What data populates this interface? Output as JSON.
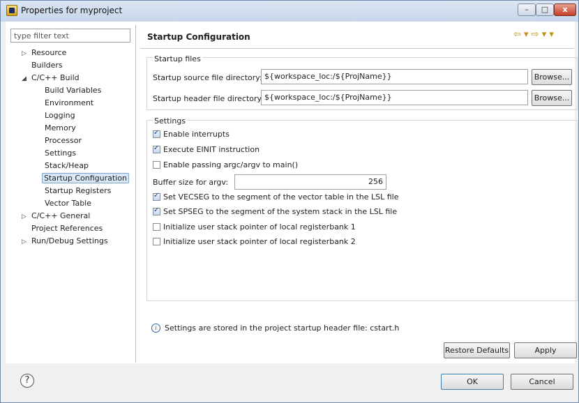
{
  "window": {
    "title": "Properties for myproject",
    "controls": {
      "minimize": "–",
      "maximize": "□",
      "close": "x"
    }
  },
  "sidebar": {
    "filter_placeholder": "type filter text",
    "items": [
      {
        "label": "Resource",
        "expandable": true
      },
      {
        "label": "Builders"
      },
      {
        "label": "C/C++ Build",
        "expanded": true
      },
      {
        "label": "Build Variables"
      },
      {
        "label": "Environment"
      },
      {
        "label": "Logging"
      },
      {
        "label": "Memory"
      },
      {
        "label": "Processor"
      },
      {
        "label": "Settings"
      },
      {
        "label": "Stack/Heap"
      },
      {
        "label": "Startup Configuration",
        "selected": true
      },
      {
        "label": "Startup Registers"
      },
      {
        "label": "Vector Table"
      },
      {
        "label": "C/C++ General",
        "expandable": true
      },
      {
        "label": "Project References"
      },
      {
        "label": "Run/Debug Settings",
        "expandable": true
      }
    ]
  },
  "page": {
    "title": "Startup Configuration",
    "nav_icons": "⇦ ▾ ⇨ ▾ ▾"
  },
  "startup_files": {
    "group_label": "Startup files",
    "source_label": "Startup source file directory:",
    "source_value": "${workspace_loc:/${ProjName}}",
    "header_label": "Startup header file directory:",
    "header_value": "${workspace_loc:/${ProjName}}",
    "browse_label": "Browse..."
  },
  "settings": {
    "group_label": "Settings",
    "options": [
      {
        "label": "Enable interrupts",
        "checked": true
      },
      {
        "label": "Execute EINIT instruction",
        "checked": true
      },
      {
        "label": "Enable passing argc/argv to main()",
        "checked": false
      }
    ],
    "buffer_label": "Buffer size for argv:",
    "buffer_value": "256",
    "options2": [
      {
        "label": "Set VECSEG to the segment of the vector table in the LSL file",
        "checked": true
      },
      {
        "label": "Set SPSEG to the segment of the system stack in the LSL file",
        "checked": true
      },
      {
        "label": "Initialize user stack pointer of local registerbank 1",
        "checked": false
      },
      {
        "label": "Initialize user stack pointer of local registerbank 2",
        "checked": false
      }
    ]
  },
  "info": {
    "icon": "i",
    "text": "Settings are stored in the project startup header file: cstart.h"
  },
  "buttons": {
    "restore_defaults": "Restore Defaults",
    "apply": "Apply",
    "ok": "OK",
    "cancel": "Cancel",
    "help": "?"
  }
}
